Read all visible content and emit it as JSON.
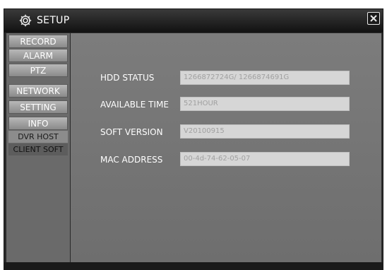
{
  "window": {
    "title": "SETUP",
    "close_label": "×"
  },
  "sidebar": {
    "items": [
      {
        "label": "RECORD"
      },
      {
        "label": "ALARM"
      },
      {
        "label": "PTZ"
      },
      {
        "label": "NETWORK"
      },
      {
        "label": "SETTING"
      },
      {
        "label": "INFO"
      }
    ],
    "subitems": [
      {
        "label": "DVR HOST"
      },
      {
        "label": "CLIENT SOFT"
      }
    ]
  },
  "info": {
    "hdd_status_label": "HDD STATUS",
    "hdd_status_value": "1266872724G/ 1266874691G",
    "available_time_label": "AVAILABLE TIME",
    "available_time_value": "521HOUR",
    "soft_version_label": "SOFT VERSION",
    "soft_version_value": "V20100915",
    "mac_address_label": "MAC ADDRESS",
    "mac_address_value": "00-4d-74-62-05-07"
  },
  "colors": {
    "window_bg": "#2a2a2a",
    "sidebar_bg": "#6a6a6a",
    "content_bg": "#767676",
    "field_bg": "#d6d6d6",
    "field_text": "#a0a0a0"
  },
  "icons": {
    "title": "gear-icon",
    "close": "close-icon"
  }
}
